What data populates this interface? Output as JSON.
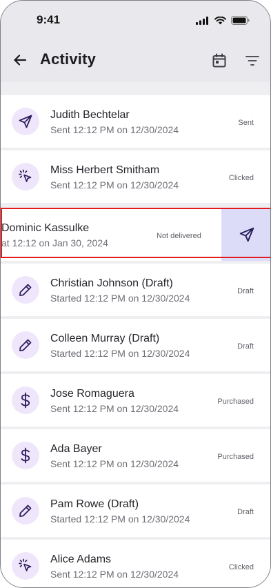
{
  "status_bar": {
    "time": "9:41"
  },
  "header": {
    "title": "Activity"
  },
  "activities": [
    {
      "name": "Judith Bechtelar",
      "detail": "Sent 12:12 PM on 12/30/2024",
      "status": "Sent",
      "icon": "send-icon"
    },
    {
      "name": "Miss Herbert Smitham",
      "detail": "Sent 12:12 PM on 12/30/2024",
      "status": "Clicked",
      "icon": "click-icon"
    },
    {
      "name": "Dominic Kassulke",
      "detail": "at 12:12 on Jan 30, 2024",
      "status": "Not delivered",
      "icon": "send-icon"
    },
    {
      "name": "Christian Johnson (Draft)",
      "detail": "Started 12:12 PM on 12/30/2024",
      "status": "Draft",
      "icon": "pencil-icon"
    },
    {
      "name": "Colleen Murray (Draft)",
      "detail": "Started 12:12 PM on 12/30/2024",
      "status": "Draft",
      "icon": "pencil-icon"
    },
    {
      "name": "Jose Romaguera",
      "detail": "Sent 12:12 PM on 12/30/2024",
      "status": "Purchased",
      "icon": "dollar-icon"
    },
    {
      "name": "Ada Bayer",
      "detail": "Sent 12:12 PM on 12/30/2024",
      "status": "Purchased",
      "icon": "dollar-icon"
    },
    {
      "name": "Pam Rowe (Draft)",
      "detail": "Started 12:12 PM on 12/30/2024",
      "status": "Draft",
      "icon": "pencil-icon"
    },
    {
      "name": "Alice Adams",
      "detail": "Sent 12:12 PM on 12/30/2024",
      "status": "Clicked",
      "icon": "click-icon"
    }
  ],
  "colors": {
    "accent": "#2b1f5c",
    "avatar_bg": "#f0e6fb",
    "swipe_action_bg": "#dcdcf9",
    "highlight": "#e21c1c"
  }
}
